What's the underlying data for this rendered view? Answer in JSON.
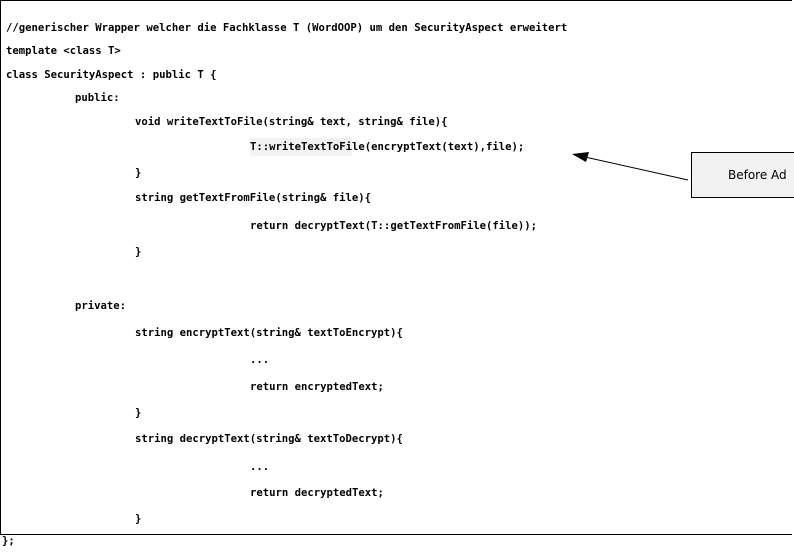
{
  "code": {
    "lines": [
      "//generischer Wrapper welcher die Fachklasse T (WordOOP) um den SecurityAspect erweitert",
      "template <class T>",
      "class SecurityAspect : public T {",
      "public:",
      "void writeTextToFile(string& text, string& file){",
      "T::writeTextToFile(encryptText(text),file);",
      "}",
      "string getTextFromFile(string& file){",
      "return decryptText(T::getTextFromFile(file));",
      "}",
      "private:",
      "string encryptText(string& textToEncrypt){",
      "...",
      "return encryptedText;",
      "}",
      "string decryptText(string& textToDecrypt){",
      "...",
      "return decryptedText;",
      "}",
      "};"
    ]
  },
  "callout": {
    "label": "Before Ad"
  }
}
